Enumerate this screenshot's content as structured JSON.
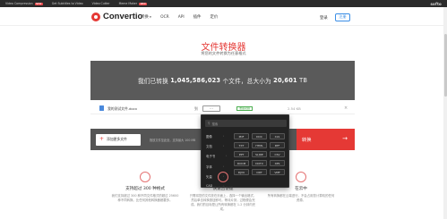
{
  "topstrip": {
    "links": [
      {
        "label": "Video Compression",
        "badge": "NEW"
      },
      {
        "label": "Get Subtitles to Video",
        "badge": ""
      },
      {
        "label": "Video Cutter",
        "badge": ""
      },
      {
        "label": "Meme Maker",
        "badge": "NEW"
      }
    ],
    "brand": "softo"
  },
  "navbar": {
    "logo": "Convertio",
    "links": [
      "转换",
      "OCR",
      "API",
      "插件",
      "定价"
    ],
    "login": "登录",
    "signup": "注册"
  },
  "hero": {
    "title": "文件转换器",
    "subtitle": "将您的文件转换为任意格式"
  },
  "banner": {
    "prefix": "我们已转换",
    "files": "1,045,586,023",
    "middle": "个文件，总大小为",
    "size": "20,601",
    "unit": "TB"
  },
  "file": {
    "name": "我的测试文件.docx",
    "convert_label": "到",
    "format": "...",
    "status": "准备就绪",
    "size": "2.54 KB"
  },
  "actions": {
    "add_label": "添加更多文件",
    "hint": "拖放文件至此处，支持最大 100 MB",
    "convert_label": "转换"
  },
  "popup": {
    "search_placeholder": "搜索",
    "categories": [
      "图像",
      "文档",
      "电子书",
      "字体",
      "矢量",
      "CAD"
    ],
    "formats": [
      "PDF",
      "DOC",
      "XLS",
      "TXT",
      "HTML",
      "RTF",
      "PPT",
      "SLIDE",
      "CSV",
      "DOCM",
      "DOTX",
      "XPS",
      "DJVU",
      "ODT",
      "VMF"
    ]
  },
  "features": [
    {
      "title": "支持超过 300 种格式",
      "desc": "我们支持超过 300 种不同文件格式的超过 25600 种不同转换。比任何其他转换器都要多。"
    },
    {
      "title": "快速且便捷",
      "desc": "只需将您的文件放在页面上，选择一个输出格式，然后单击转换按钮即可。等待片刻，过程便会完成。我们的目标是让所有转换都在 1-2 分钟内完成。"
    },
    {
      "title": "在云中",
      "desc": "所有转换都在云端进行，不会占用您计算机的任何资源。"
    }
  ],
  "colors": {
    "accent": "#e53935",
    "banner": "#5a5a5a",
    "link": "#3a8ee6"
  }
}
